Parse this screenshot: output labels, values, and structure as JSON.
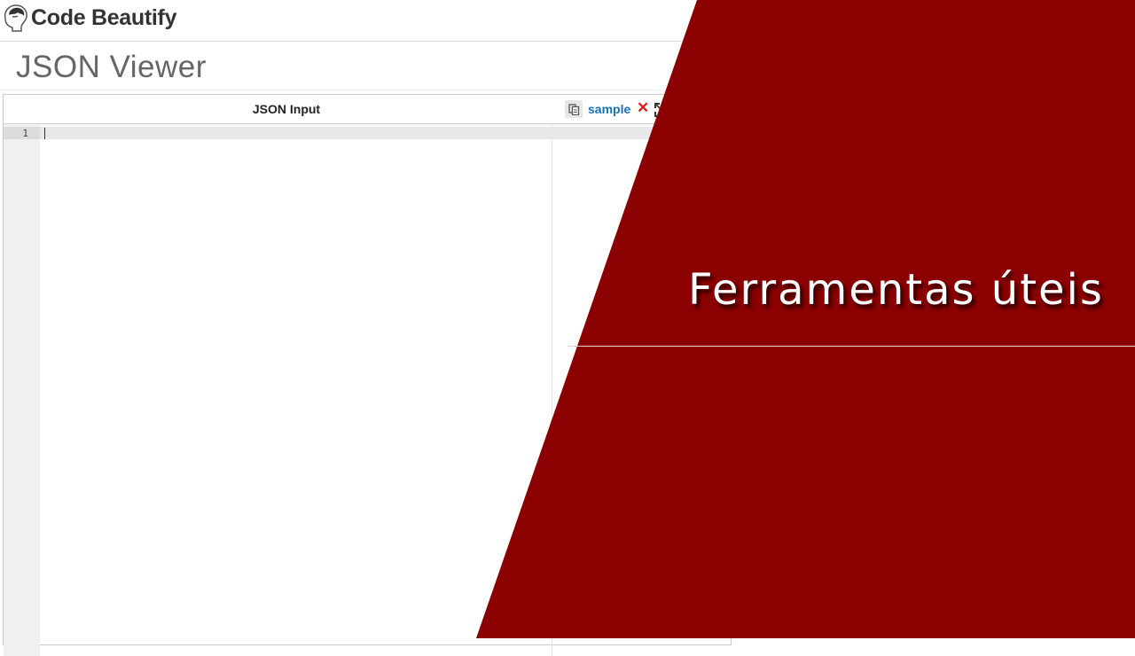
{
  "header": {
    "logo_text": "Code Beautify",
    "logo_icon": "brain-head-icon"
  },
  "page": {
    "title": "JSON Viewer"
  },
  "editor": {
    "title": "JSON Input",
    "copy_icon": "copy-icon",
    "sample_label": "sample",
    "clear_icon": "close-icon",
    "fullscreen_icon": "fullscreen-icon",
    "line_number": "1",
    "content": ""
  },
  "overlay": {
    "title": "Ferramentas úteis",
    "bg_color": "#8b0000",
    "line_color": "#e8d0d0"
  }
}
